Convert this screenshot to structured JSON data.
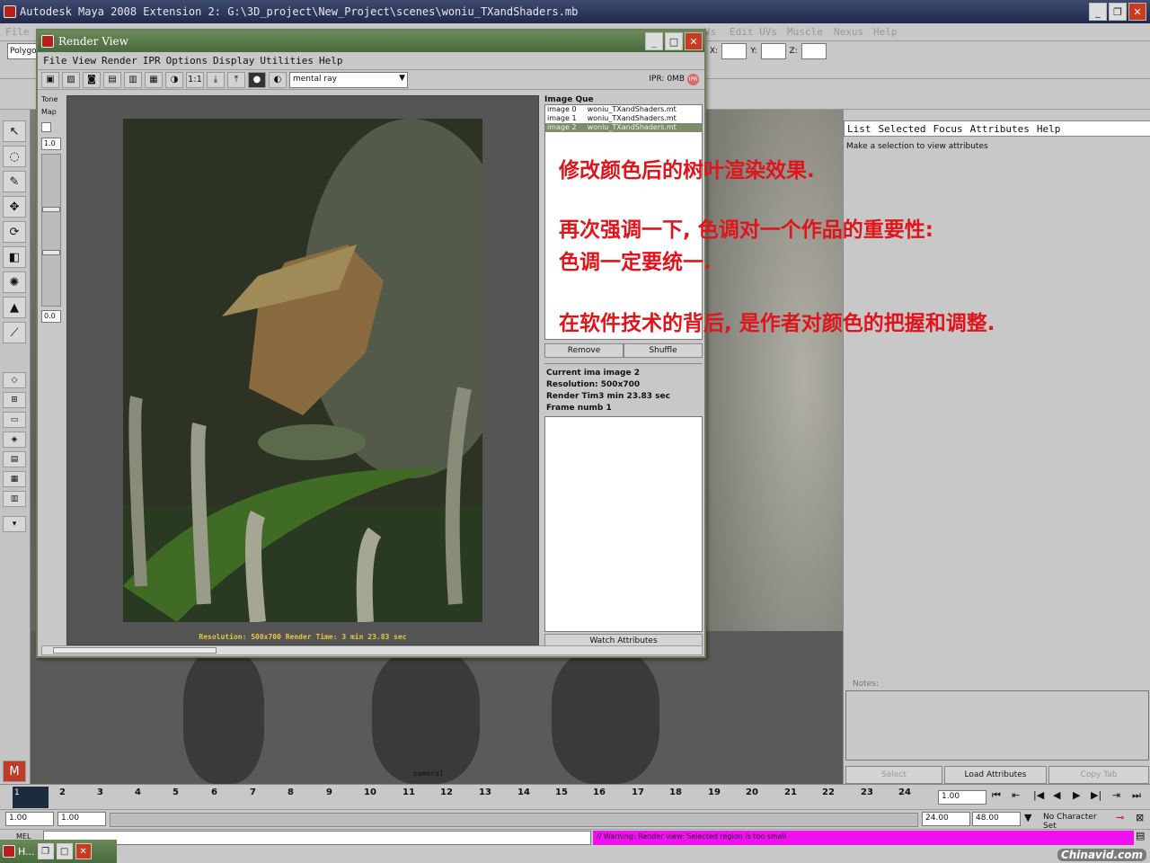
{
  "maya": {
    "title": "Autodesk Maya 2008 Extension 2: G:\\3D_project\\New_Project\\scenes\\woniu_TXandShaders.mb",
    "menus_visible": [
      "File",
      "Vs",
      "Edit UVs",
      "Muscle",
      "Nexus",
      "Help"
    ],
    "mode": "Polygo",
    "xyz_labels": [
      "X:",
      "Y:",
      "Z:"
    ]
  },
  "render_view": {
    "title": "Render View",
    "menu": [
      "File",
      "View",
      "Render",
      "IPR",
      "Options",
      "Display",
      "Utilities",
      "Help"
    ],
    "renderer": "mental ray",
    "ratio_label": "1:1",
    "ipr_label": "IPR: 0MB",
    "ipr_badge": "IPR",
    "tone_map": {
      "label1": "Tone",
      "label2": "Map",
      "value_top": "1.0",
      "value_bottom": "0.0"
    },
    "caption": "Resolution:  500x700     Render Time:  3 min 23.83 sec",
    "image_queue": {
      "header": "Image Que",
      "items": [
        {
          "id": "image 0",
          "name": "woniu_TXandShaders.mt"
        },
        {
          "id": "image 1",
          "name": "woniu_TXandShaders.mt"
        },
        {
          "id": "image 2",
          "name": "woniu_TXandShaders.mt"
        }
      ],
      "remove_label": "Remove",
      "shuffle_label": "Shuffle",
      "current": "Current ima image 2",
      "resolution": "Resolution: 500x700",
      "render_time": "Render Tim3 min 23.83 sec",
      "frame": "Frame numb 1",
      "watch_label": "Watch Attributes"
    }
  },
  "annotations": [
    "修改颜色后的树叶渲染效果.",
    "再次强调一下, 色调对一个作品的重要性:",
    "色调一定要统一.",
    "在软件技术的背后, 是作者对颜色的把握和调整."
  ],
  "attribute_editor": {
    "menu": [
      "List",
      "Selected",
      "Focus",
      "Attributes",
      "Help"
    ],
    "hint": "Make a selection to view attributes",
    "notes_label": "Notes:",
    "select_label": "Select",
    "load_label": "Load Attributes",
    "copy_label": "Copy Tab"
  },
  "viewport": {
    "camera_label": "camera1"
  },
  "timeline": {
    "current_frame": "1",
    "ticks": [
      "2",
      "3",
      "4",
      "5",
      "6",
      "7",
      "8",
      "9",
      "10",
      "11",
      "12",
      "13",
      "14",
      "15",
      "16",
      "17",
      "18",
      "19",
      "20",
      "21",
      "22",
      "23",
      "24"
    ],
    "current_time_field": "1.00",
    "range_start": "1.00",
    "range_start2": "1.00",
    "range_end": "24.00",
    "range_end2": "48.00",
    "character_set": "No Character Set"
  },
  "command": {
    "mel_label": "MEL",
    "warning": "// Warning: Render view: Selected region is too small"
  },
  "taskbar": {
    "label": "H..."
  },
  "watermark": "Chinavid.com",
  "colors": {
    "annotation": "#e0151b",
    "warning_bg": "#f00ff0",
    "render_caption": "#e7c641"
  }
}
